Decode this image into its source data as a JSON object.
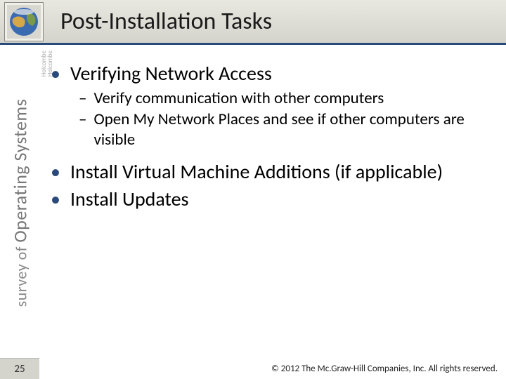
{
  "header": {
    "title": "Post-Installation Tasks",
    "icon": "globe-icon"
  },
  "sidebar": {
    "prefix": "survey of",
    "main": "Operating Systems",
    "author1": "Holcombe",
    "author2": "Holcombe"
  },
  "content": {
    "b1": "Verifying Network Access",
    "b1_1": "Verify communication with other computers",
    "b1_2": "Open My Network Places and see if other computers are visible",
    "b2": "Install Virtual Machine Additions (if applicable)",
    "b3": "Install Updates"
  },
  "footer": {
    "page": "25",
    "copyright": "© 2012 The Mc.Graw-Hill Companies, Inc. All rights reserved."
  }
}
